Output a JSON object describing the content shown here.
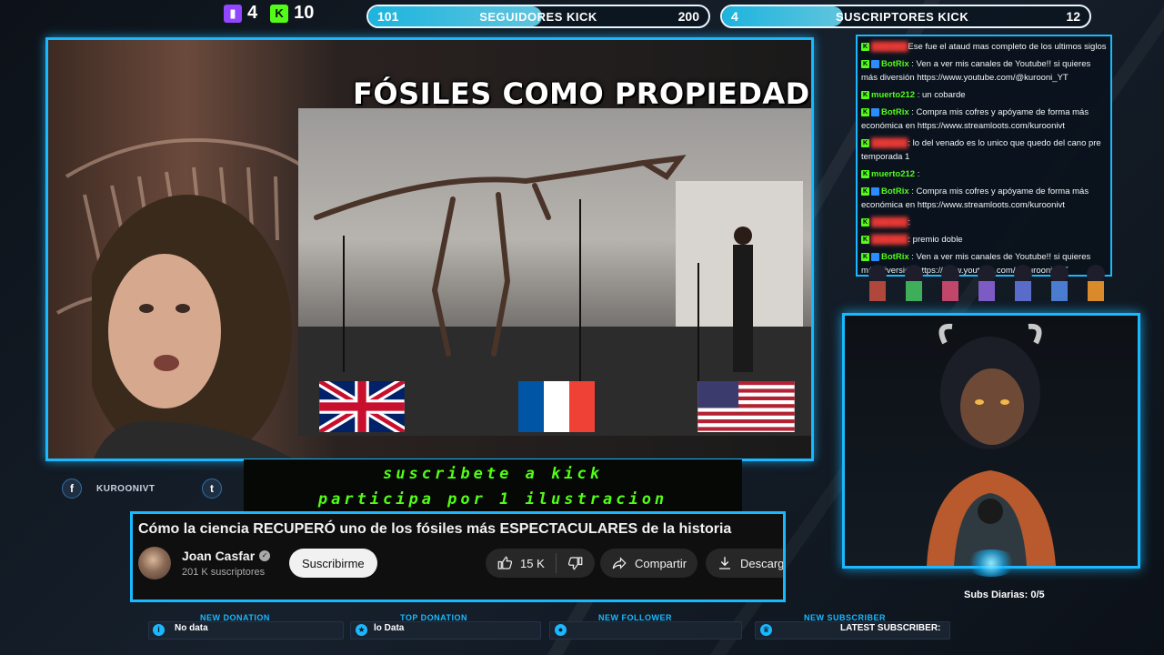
{
  "top_counters": {
    "twitch_count": "4",
    "kick_count": "10"
  },
  "followers_bar": {
    "current": "101",
    "title": "SEGUIDORES KICK",
    "goal": "200",
    "progress": 0.51
  },
  "subs_bar": {
    "current": "4",
    "title": "SUSCRIPTORES KICK",
    "goal": "12",
    "progress": 0.33
  },
  "video": {
    "overlay_title": "FÓSILES COMO PROPIEDAD",
    "flags": [
      "uk-flag",
      "france-flag",
      "usa-flag"
    ]
  },
  "chat": {
    "messages": [
      {
        "user": "",
        "text": "Ese fue el ataud mas completo de los ultimos siglos",
        "user_color": "#e53935"
      },
      {
        "user": "BotRix",
        "text": ": Ven a ver mis canales de Youtube!! si quieres más diversión https://www.youtube.com/@kurooni_YT",
        "user_color": "#53fc18"
      },
      {
        "user": "muerto212",
        "text": ": un cobarde",
        "user_color": "#53fc18"
      },
      {
        "user": "BotRix",
        "text": ": Compra mis cofres y apóyame de forma más económica en https://www.streamloots.com/kuroonivt",
        "user_color": "#53fc18"
      },
      {
        "user": "",
        "text": ": lo del venado es lo unico que quedo del cano pre temporada 1",
        "user_color": "#e53935"
      },
      {
        "user": "muerto212",
        "text": ":",
        "user_color": "#53fc18"
      },
      {
        "user": "BotRix",
        "text": ": Compra mis cofres y apóyame de forma más económica en https://www.streamloots.com/kuroonivt",
        "user_color": "#53fc18"
      },
      {
        "user": "",
        "text": ":",
        "user_color": "#e53935"
      },
      {
        "user": "",
        "text": ": premio doble",
        "user_color": "#e53935"
      },
      {
        "user": "BotRix",
        "text": ": Ven a ver mis canales de Youtube!! si quieres más diversión https://www.youtube.com/@kurooni_YT",
        "user_color": "#53fc18"
      }
    ]
  },
  "socials": {
    "facebook_label": "KUROONIVT"
  },
  "kick_banner": {
    "line1": "suscribete a kick",
    "line2": "participa por 1 ilustracion"
  },
  "youtube": {
    "title": "Cómo la ciencia RECUPERÓ uno de los fósiles más ESPECTACULARES de la historia",
    "channel": "Joan Casfar",
    "subscribers": "201 K suscriptores",
    "subscribe_label": "Suscribirme",
    "likes": "15 K",
    "share_label": "Compartir",
    "download_label": "Descarga"
  },
  "subs_diarias": {
    "label": "Subs Diarias:",
    "value": "0/5"
  },
  "alerts": {
    "new_donation": {
      "title": "NEW DONATION",
      "value": "No data"
    },
    "top_donation": {
      "title": "TOP DONATION",
      "value": "lo Data"
    },
    "new_follower": {
      "title": "NEW FOLLOWER",
      "value": ""
    },
    "new_subscriber": {
      "title": "NEW SUBSCRIBER",
      "value": "LATEST SUBSCRIBER:"
    }
  },
  "colors": {
    "accent": "#19b8ff",
    "kick_green": "#53fc18",
    "twitch_purple": "#9146ff"
  }
}
